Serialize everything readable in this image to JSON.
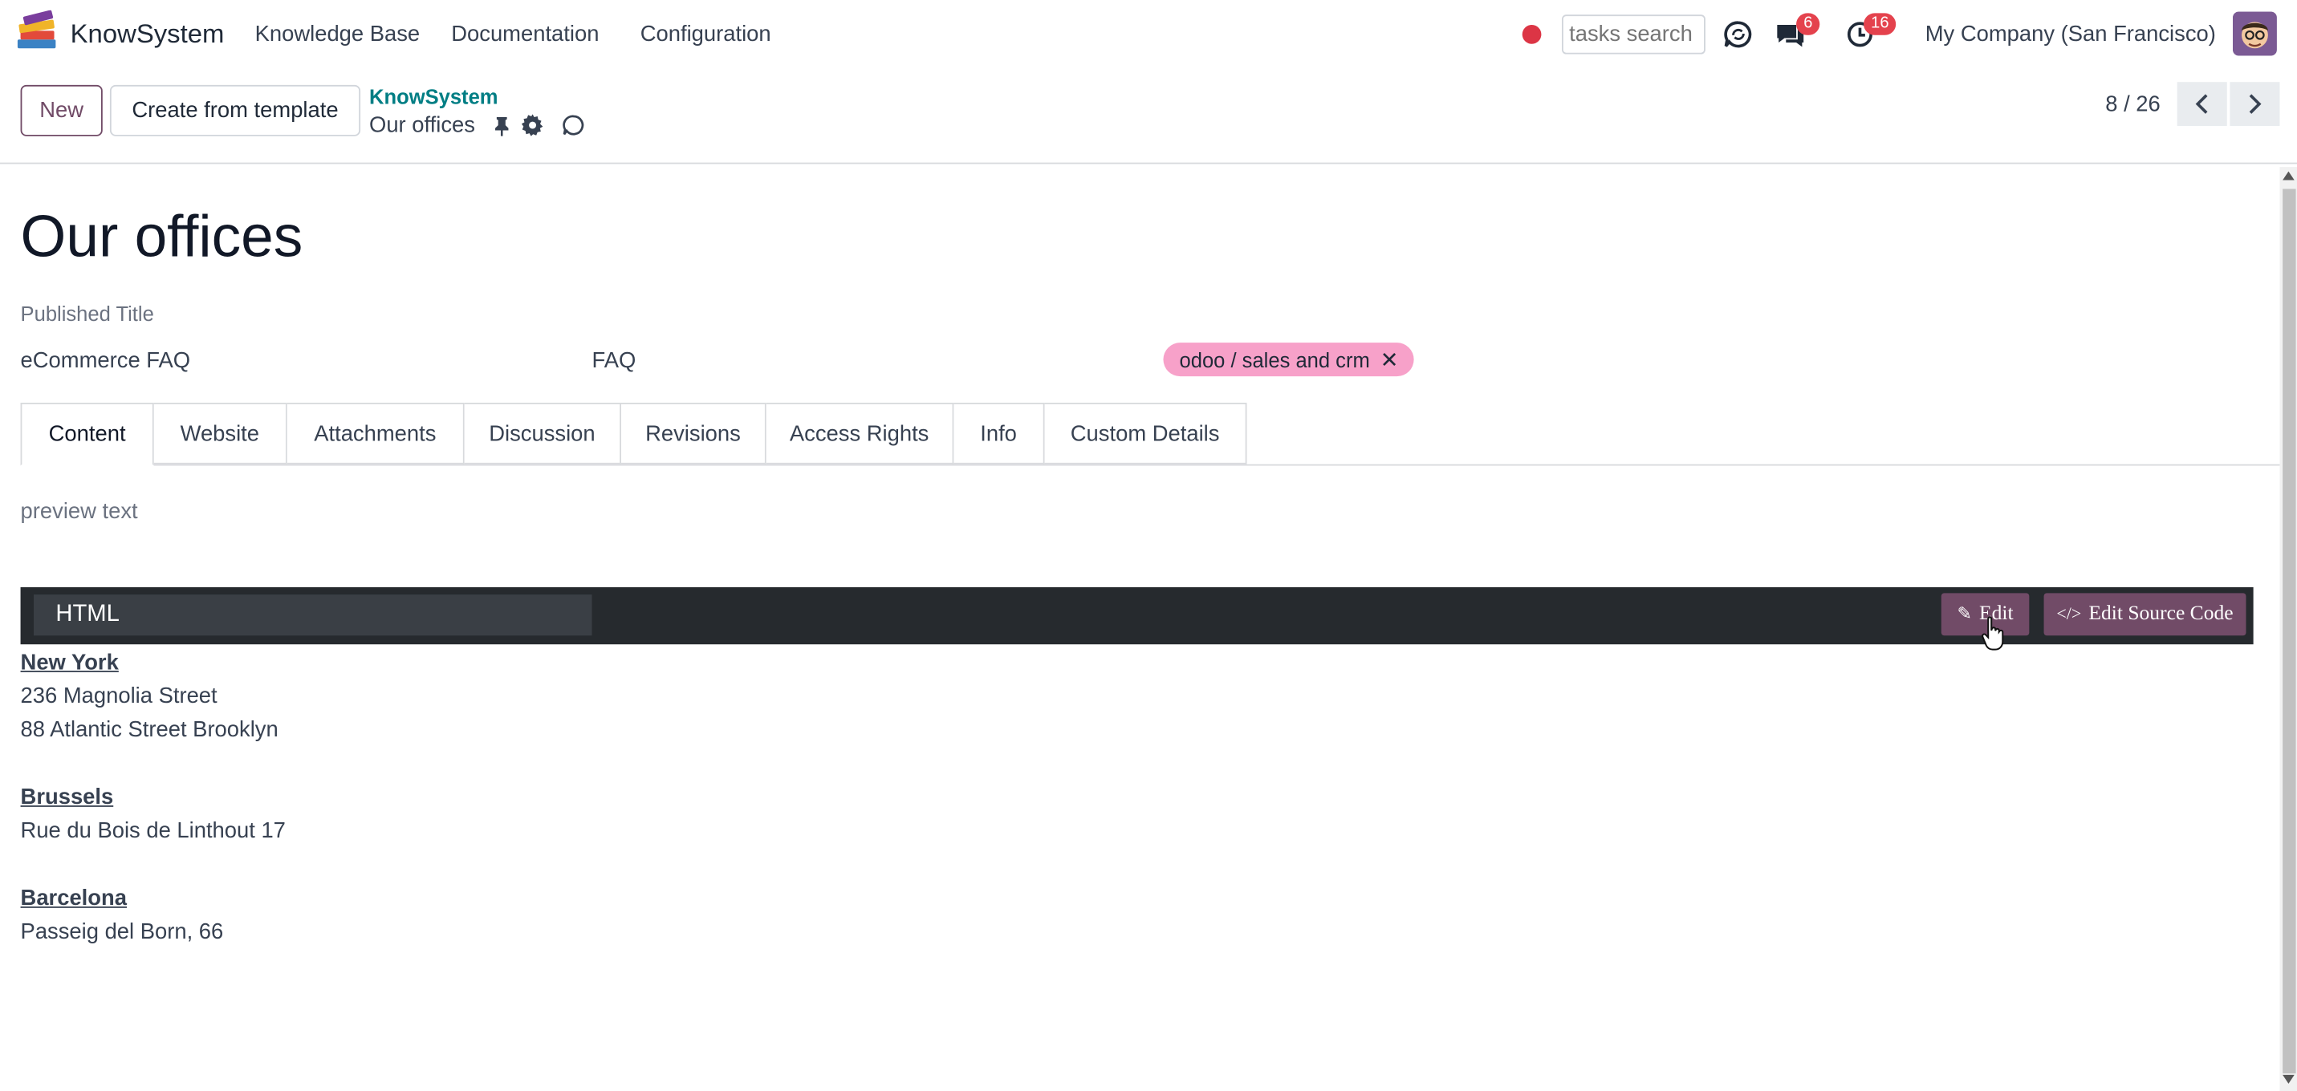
{
  "navbar": {
    "app_name": "KnowSystem",
    "menu": [
      "Knowledge Base",
      "Documentation",
      "Configuration"
    ],
    "search_placeholder": "tasks search",
    "messages_count": "6",
    "activities_count": "16",
    "company": "My Company (San Francisco)"
  },
  "control_panel": {
    "new_label": "New",
    "template_label": "Create from template",
    "breadcrumb_parent": "KnowSystem",
    "breadcrumb_current": "Our offices",
    "pager": "8 / 26"
  },
  "form": {
    "title": "Our offices",
    "published_title_label": "Published Title",
    "section": "eCommerce FAQ",
    "category": "FAQ",
    "tag": "odoo / sales and crm",
    "tabs": [
      "Content",
      "Website",
      "Attachments",
      "Discussion",
      "Revisions",
      "Access Rights",
      "Info",
      "Custom Details"
    ],
    "preview_text": "preview text",
    "editor_mode": "HTML",
    "edit_label": "Edit",
    "edit_source_label": "Edit Source Code"
  },
  "offices": [
    {
      "city": "New York",
      "lines": [
        "236 Magnolia Street",
        "88 Atlantic Street Brooklyn"
      ]
    },
    {
      "city": "Brussels",
      "lines": [
        "Rue du Bois de Linthout 17"
      ]
    },
    {
      "city": "Barcelona",
      "lines": [
        "Passeig del Born, 66"
      ]
    }
  ],
  "colors": {
    "accent": "#714B67",
    "tag": "#f7a1c9",
    "badge": "#e4424d",
    "link": "#017e84"
  }
}
